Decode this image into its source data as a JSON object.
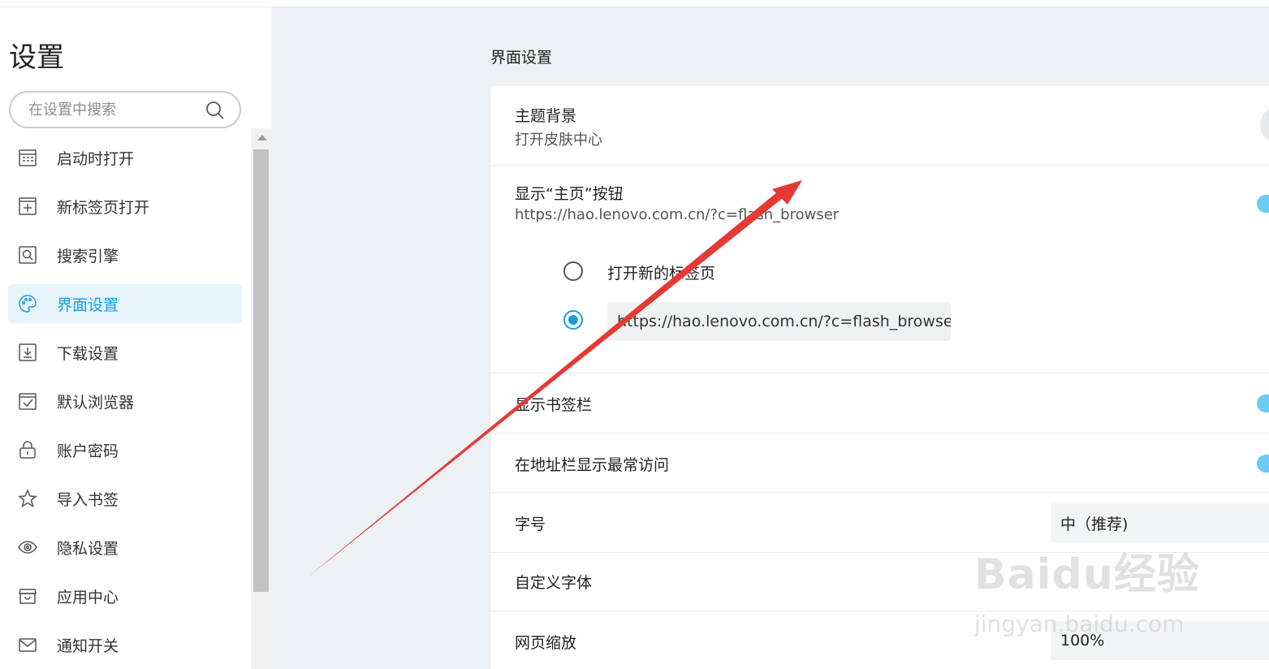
{
  "sidebar": {
    "title": "设置",
    "search_placeholder": "在设置中搜索",
    "items": [
      {
        "label": "启动时打开",
        "icon": "calendar-grid-icon"
      },
      {
        "label": "新标签页打开",
        "icon": "plus-square-icon"
      },
      {
        "label": "搜索引擎",
        "icon": "search-square-icon"
      },
      {
        "label": "界面设置",
        "icon": "palette-icon",
        "active": true
      },
      {
        "label": "下载设置",
        "icon": "download-icon"
      },
      {
        "label": "默认浏览器",
        "icon": "check-calendar-icon"
      },
      {
        "label": "账户密码",
        "icon": "lock-icon"
      },
      {
        "label": "导入书签",
        "icon": "star-icon"
      },
      {
        "label": "隐私设置",
        "icon": "eye-icon"
      },
      {
        "label": "应用中心",
        "icon": "store-icon"
      },
      {
        "label": "通知开关",
        "icon": "mail-icon"
      }
    ]
  },
  "main": {
    "section_title": "界面设置",
    "theme": {
      "title": "主题背景",
      "subtitle": "打开皮肤中心"
    },
    "home_button": {
      "title": "显示“主页”按钮",
      "subtitle": "https://hao.lenovo.com.cn/?c=flash_browser",
      "option_new_tab": "打开新的标签页",
      "option_url_value": "https://hao.lenovo.com.cn/?c=flash_browser"
    },
    "bookmarks_bar": {
      "title": "显示书签栏"
    },
    "most_visited": {
      "title": "在地址栏显示最常访问"
    },
    "font_size": {
      "title": "字号",
      "value": "中（推荐)"
    },
    "custom_font": {
      "title": "自定义字体"
    },
    "page_zoom": {
      "title": "网页缩放",
      "value": "100%"
    }
  },
  "watermark": {
    "brand": "Baidu经验",
    "url": "jingyan.baidu.com"
  },
  "colors": {
    "accent": "#1a9de0",
    "toggle": "#6ccbf3",
    "arrow": "#e53935"
  }
}
